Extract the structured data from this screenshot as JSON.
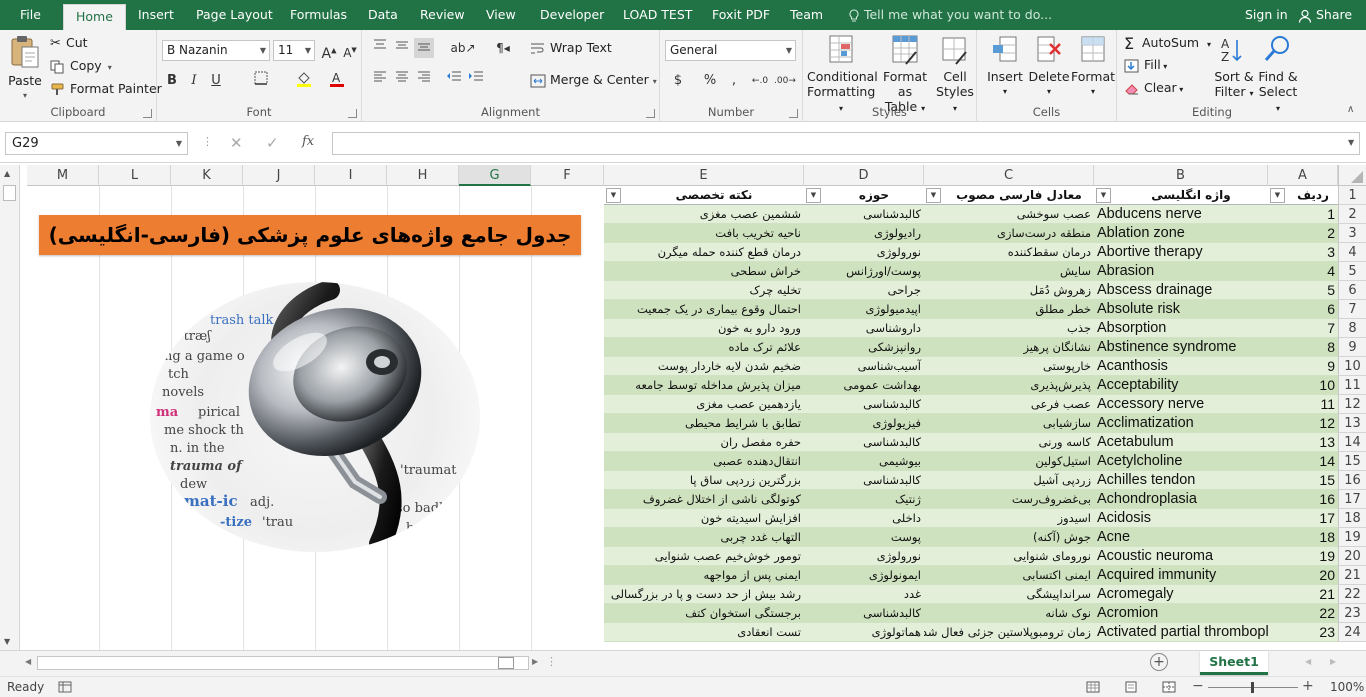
{
  "menu": {
    "tabs": [
      "File",
      "Home",
      "Insert",
      "Page Layout",
      "Formulas",
      "Data",
      "Review",
      "View",
      "Developer",
      "LOAD TEST",
      "Foxit PDF",
      "Team"
    ],
    "active": "Home",
    "tell_me": "Tell me what you want to do...",
    "sign_in": "Sign in",
    "share": "Share"
  },
  "ribbon": {
    "clipboard": {
      "label": "Clipboard",
      "paste": "Paste",
      "cut": "Cut",
      "copy": "Copy",
      "format_painter": "Format Painter"
    },
    "font": {
      "label": "Font",
      "name": "B Nazanin",
      "size": "11"
    },
    "alignment": {
      "label": "Alignment",
      "wrap_text": "Wrap Text",
      "merge_center": "Merge & Center"
    },
    "number": {
      "label": "Number",
      "format": "General"
    },
    "styles": {
      "label": "Styles",
      "cond1": "Conditional",
      "cond2": "Formatting",
      "fmt1": "Format as",
      "fmt2": "Table",
      "cell1": "Cell",
      "cell2": "Styles"
    },
    "cells": {
      "label": "Cells",
      "insert": "Insert",
      "delete": "Delete",
      "format": "Format"
    },
    "editing": {
      "label": "Editing",
      "autosum": "AutoSum",
      "fill": "Fill",
      "clear": "Clear",
      "sort1": "Sort &",
      "sort2": "Filter",
      "find1": "Find &",
      "find2": "Select"
    }
  },
  "formula_bar": {
    "name_box": "G29",
    "value": ""
  },
  "columns": [
    "M",
    "L",
    "K",
    "J",
    "I",
    "H",
    "G",
    "F",
    "E",
    "D",
    "C",
    "B",
    "A"
  ],
  "selected_column": "G",
  "row_numbers": [
    "1",
    "2",
    "3",
    "4",
    "5",
    "6",
    "7",
    "8",
    "9",
    "10",
    "11",
    "12",
    "13",
    "14",
    "15",
    "16",
    "17",
    "18",
    "19",
    "20",
    "21",
    "22",
    "23",
    "24"
  ],
  "table": {
    "headers": {
      "a": "ردیف",
      "b": "واژه انگلیسی",
      "c": "معادل فارسی مصوب",
      "d": "حوزه",
      "e": "نکته تخصصی"
    },
    "rows": [
      {
        "a": "1",
        "b": "Abducens nerve",
        "c": "عصب سوخشی",
        "d": "کالبدشناسی",
        "e": "ششمین عصب مغزی"
      },
      {
        "a": "2",
        "b": "Ablation zone",
        "c": "منطقه درست‌سازی",
        "d": "رادیولوژی",
        "e": "ناحیه تخریب بافت"
      },
      {
        "a": "3",
        "b": "Abortive therapy",
        "c": "درمان سقط‌کننده",
        "d": "نورولوژی",
        "e": "درمان قطع کننده حمله میگرن"
      },
      {
        "a": "4",
        "b": "Abrasion",
        "c": "سایش",
        "d": "پوست/اورژانس",
        "e": "خراش سطحی"
      },
      {
        "a": "5",
        "b": "Abscess drainage",
        "c": "زهروش دُمَل",
        "d": "جراحی",
        "e": "تخلیه چرک"
      },
      {
        "a": "6",
        "b": "Absolute risk",
        "c": "خطر مطلق",
        "d": "اپیدمیولوژی",
        "e": "احتمال وقوع بیماری در یک جمعیت"
      },
      {
        "a": "7",
        "b": "Absorption",
        "c": "جذب",
        "d": "داروشناسی",
        "e": "ورود دارو به خون"
      },
      {
        "a": "8",
        "b": "Abstinence syndrome",
        "c": "نشانگان پرهیز",
        "d": "روانپزشکی",
        "e": "علائم ترک ماده"
      },
      {
        "a": "9",
        "b": "Acanthosis",
        "c": "خارپوستی",
        "d": "آسیب‌شناسی",
        "e": "ضخیم شدن لایه خاردار پوست"
      },
      {
        "a": "10",
        "b": "Acceptability",
        "c": "پذیرش‌پذیری",
        "d": "بهداشت عمومی",
        "e": "میزان پذیرش مداخله توسط جامعه"
      },
      {
        "a": "11",
        "b": "Accessory nerve",
        "c": "عصب فرعی",
        "d": "کالبدشناسی",
        "e": "یازدهمین عصب مغزی"
      },
      {
        "a": "12",
        "b": "Acclimatization",
        "c": "سازشیابی",
        "d": "فیزیولوژی",
        "e": "تطابق با شرایط محیطی"
      },
      {
        "a": "13",
        "b": "Acetabulum",
        "c": "کاسه ورنی",
        "d": "کالبدشناسی",
        "e": "حفره مفصل ران"
      },
      {
        "a": "14",
        "b": "Acetylcholine",
        "c": "استیل‌کولین",
        "d": "بیوشیمی",
        "e": "انتقال‌دهنده عصبی"
      },
      {
        "a": "15",
        "b": "Achilles tendon",
        "c": "زردپی آشیل",
        "d": "کالبدشناسی",
        "e": "بزرگترین زردپی ساق پا"
      },
      {
        "a": "16",
        "b": "Achondroplasia",
        "c": "بی‌غضروف‌رست",
        "d": "ژنتیک",
        "e": "کوتولگی ناشی از اختلال غضروف"
      },
      {
        "a": "17",
        "b": "Acidosis",
        "c": "اسیدوز",
        "d": "داخلی",
        "e": "افزایش اسیدیته خون"
      },
      {
        "a": "18",
        "b": "Acne",
        "c": "جوش (آکنه)",
        "d": "پوست",
        "e": "التهاب غدد چربی"
      },
      {
        "a": "19",
        "b": "Acoustic neuroma",
        "c": "نورومای شنوایی",
        "d": "نورولوژی",
        "e": "تومور خوش‌خیم عصب شنوایی"
      },
      {
        "a": "20",
        "b": "Acquired immunity",
        "c": "ایمنی اکتسابی",
        "d": "ایمونولوژی",
        "e": "ایمنی پس از مواجهه"
      },
      {
        "a": "21",
        "b": "Acromegaly",
        "c": "سرانداپیشگی",
        "d": "غدد",
        "e": "رشد بیش از حد دست و پا در بزرگسالی"
      },
      {
        "a": "22",
        "b": "Acromion",
        "c": "نوک شانه",
        "d": "کالبدشناسی",
        "e": "برجستگی استخوان کتف"
      },
      {
        "a": "23",
        "b": "Activated partial thromboplastin time",
        "c": "زمان ترومبوپلاستین جزئی فعال شده",
        "d": "هماتولوژی",
        "e": "تست انعقادی"
      }
    ]
  },
  "banner_title": "جدول جامع واژه‌های علوم پزشکی (فارسی-انگلیسی)",
  "photo_text": {
    "l1": "trash talk",
    "l2": "'træʃ",
    "l3": "ng a game o",
    "l4": "tch",
    "l5": "novels",
    "l6": "ma",
    "l7": "pirical",
    "l8": "me shock th",
    "l9": "n. in the",
    "l10": "trauma of",
    "l11": "dew",
    "l12": "mat-ic",
    "l13": "adj.",
    "l14": "-tize",
    "l15": "'trau",
    "l16": "'traumat",
    "l17": "so badly th",
    "l18": "bodily i"
  },
  "sheet_tab": "Sheet1",
  "status": {
    "ready": "Ready",
    "zoom": "100%"
  },
  "colors": {
    "accent": "#217346",
    "orange": "#ed7d31",
    "row_light": "#e3efd9",
    "row_dark": "#cfe2bf"
  }
}
